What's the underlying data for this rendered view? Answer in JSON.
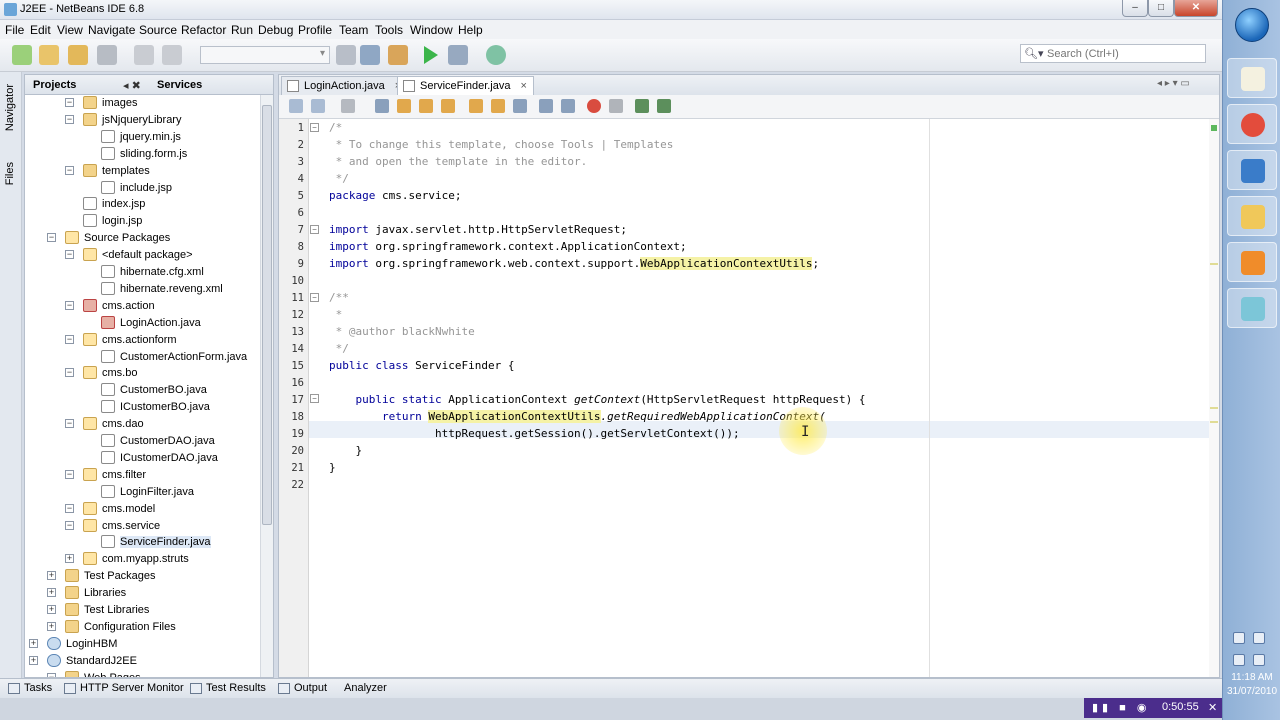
{
  "window": {
    "title": "J2EE - NetBeans IDE 6.8",
    "minimize": "–",
    "maximize": "□",
    "close": "✕"
  },
  "menu": [
    "File",
    "Edit",
    "View",
    "Navigate",
    "Source",
    "Refactor",
    "Run",
    "Debug",
    "Profile",
    "Team",
    "Tools",
    "Window",
    "Help"
  ],
  "toolbar": {
    "search_placeholder": "Search (Ctrl+I)"
  },
  "left_strip": {
    "navigator": "Navigator",
    "files": "Files"
  },
  "projects_panel": {
    "tab_projects": "Projects",
    "tab_services": "Services",
    "tree": [
      {
        "label": "images",
        "icon": "folder-icon"
      },
      {
        "label": "jsNjqueryLibrary",
        "icon": "folder-icon"
      },
      {
        "label": "jquery.min.js",
        "icon": "js-file-icon"
      },
      {
        "label": "sliding.form.js",
        "icon": "js-file-icon"
      },
      {
        "label": "templates",
        "icon": "folder-icon"
      },
      {
        "label": "include.jsp",
        "icon": "jsp-file-icon"
      },
      {
        "label": "index.jsp",
        "icon": "jsp-file-icon"
      },
      {
        "label": "login.jsp",
        "icon": "jsp-file-icon"
      },
      {
        "label": "Source Packages",
        "icon": "source-packages-icon"
      },
      {
        "label": "<default package>",
        "icon": "package-icon"
      },
      {
        "label": "hibernate.cfg.xml",
        "icon": "xml-file-icon"
      },
      {
        "label": "hibernate.reveng.xml",
        "icon": "xml-file-icon"
      },
      {
        "label": "cms.action",
        "icon": "package-error-icon"
      },
      {
        "label": "LoginAction.java",
        "icon": "java-error-file-icon"
      },
      {
        "label": "cms.actionform",
        "icon": "package-icon"
      },
      {
        "label": "CustomerActionForm.java",
        "icon": "java-file-icon"
      },
      {
        "label": "cms.bo",
        "icon": "package-icon"
      },
      {
        "label": "CustomerBO.java",
        "icon": "java-file-icon"
      },
      {
        "label": "ICustomerBO.java",
        "icon": "java-file-icon"
      },
      {
        "label": "cms.dao",
        "icon": "package-icon"
      },
      {
        "label": "CustomerDAO.java",
        "icon": "java-file-icon"
      },
      {
        "label": "ICustomerDAO.java",
        "icon": "java-file-icon"
      },
      {
        "label": "cms.filter",
        "icon": "package-icon"
      },
      {
        "label": "LoginFilter.java",
        "icon": "java-file-icon"
      },
      {
        "label": "cms.model",
        "icon": "package-icon"
      },
      {
        "label": "cms.service",
        "icon": "package-icon"
      },
      {
        "label": "ServiceFinder.java",
        "icon": "java-file-icon"
      },
      {
        "label": "com.myapp.struts",
        "icon": "package-icon"
      },
      {
        "label": "Test Packages",
        "icon": "folder-icon"
      },
      {
        "label": "Libraries",
        "icon": "folder-icon"
      },
      {
        "label": "Test Libraries",
        "icon": "folder-icon"
      },
      {
        "label": "Configuration Files",
        "icon": "folder-icon"
      },
      {
        "label": "LoginHBM",
        "icon": "web-project-icon"
      },
      {
        "label": "StandardJ2EE",
        "icon": "web-project-icon"
      },
      {
        "label": "Web Pages",
        "icon": "folder-icon"
      }
    ]
  },
  "editor": {
    "tabs": [
      {
        "label": "LoginAction.java",
        "close": "×"
      },
      {
        "label": "ServiceFinder.java",
        "close": "×"
      }
    ],
    "lines": [
      {
        "n": "1",
        "text": "/*"
      },
      {
        "n": "2",
        "text": " * To change this template, choose Tools | Templates"
      },
      {
        "n": "3",
        "text": " * and open the template in the editor."
      },
      {
        "n": "4",
        "text": " */"
      },
      {
        "n": "5",
        "text": "package cms.service;"
      },
      {
        "n": "6",
        "text": ""
      },
      {
        "n": "7",
        "text": "import javax.servlet.http.HttpServletRequest;"
      },
      {
        "n": "8",
        "text": "import org.springframework.context.ApplicationContext;"
      },
      {
        "n": "9a",
        "text": "import org.springframework.web.context.support."
      },
      {
        "n": "9b",
        "text": "WebApplicationContextUtils"
      },
      {
        "n": "9c",
        "text": ";"
      },
      {
        "n": "10",
        "text": ""
      },
      {
        "n": "11",
        "text": "/**"
      },
      {
        "n": "12",
        "text": " *"
      },
      {
        "n": "13",
        "text": " * @author blackNwhite"
      },
      {
        "n": "14",
        "text": " */"
      },
      {
        "n": "15",
        "text": "public class ServiceFinder {"
      },
      {
        "n": "16",
        "text": ""
      },
      {
        "n": "17a",
        "text": "    public static ApplicationContext "
      },
      {
        "n": "17b",
        "text": "getContext"
      },
      {
        "n": "17c",
        "text": "(HttpServletRequest httpRequest) {"
      },
      {
        "n": "18a",
        "text": "        return "
      },
      {
        "n": "18b",
        "text": "WebApplicationContextUtils"
      },
      {
        "n": "18c",
        "text": ".getRequiredWebApplicationContext("
      },
      {
        "n": "19",
        "text": "                httpRequest.getSession().getServletContext());"
      },
      {
        "n": "20",
        "text": "    }"
      },
      {
        "n": "21",
        "text": "}"
      },
      {
        "n": "22",
        "text": ""
      }
    ],
    "line_numbers": [
      "1",
      "2",
      "3",
      "4",
      "5",
      "6",
      "7",
      "8",
      "9",
      "10",
      "11",
      "12",
      "13",
      "14",
      "15",
      "16",
      "17",
      "18",
      "19",
      "20",
      "21",
      "22"
    ]
  },
  "status": {
    "tasks": "Tasks",
    "http_monitor": "HTTP Server Monitor",
    "test_results": "Test Results",
    "output": "Output",
    "analyzer": "Analyzer"
  },
  "recorder": {
    "time": "0:50:55"
  },
  "taskbar": {
    "time": "11:18 AM",
    "date": "31/07/2010"
  },
  "colors": {
    "keyword": "#000099",
    "comment": "#969696",
    "highlight": "#f5f2a6",
    "current_line": "#eaf0f8"
  }
}
